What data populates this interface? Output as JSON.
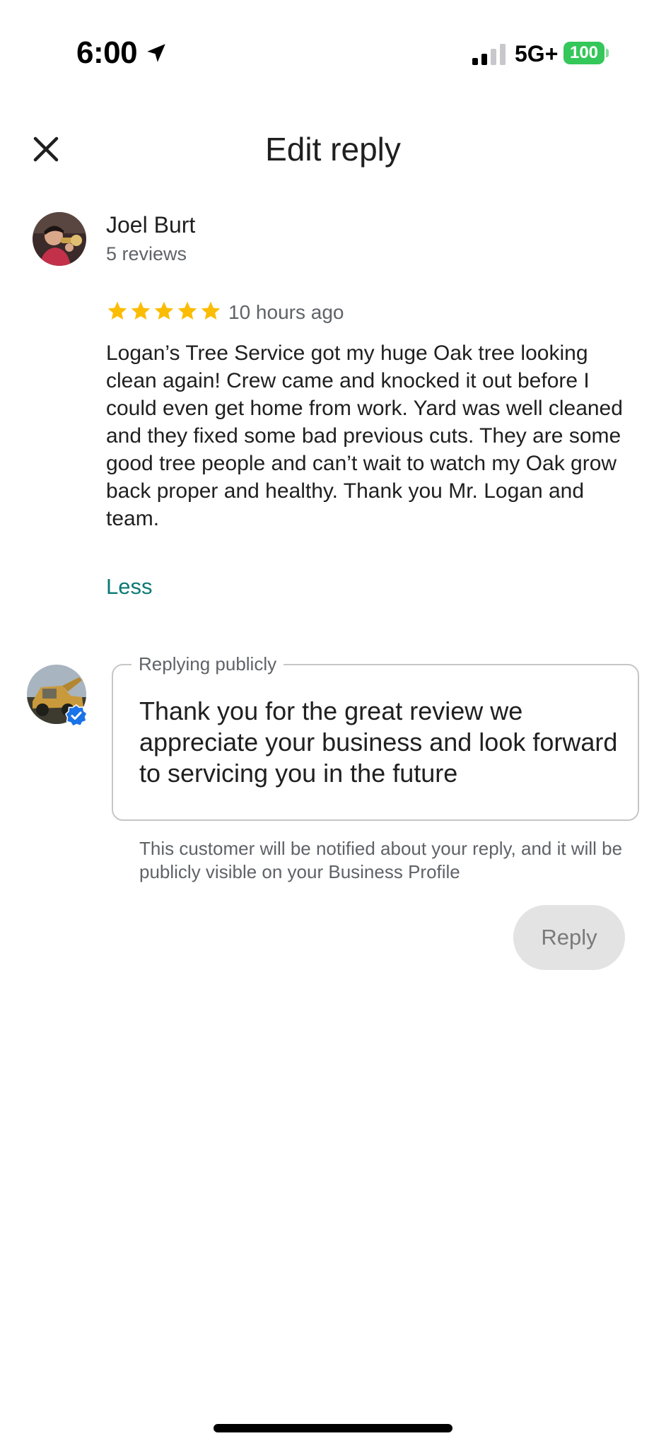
{
  "status_bar": {
    "time": "6:00",
    "network": "5G+",
    "battery": "100",
    "battery_color": "#34c759",
    "icons": [
      "location-arrow-icon",
      "signal-icon",
      "battery-icon"
    ]
  },
  "header": {
    "title": "Edit reply",
    "close_icon": "close-icon"
  },
  "review": {
    "reviewer_name": "Joel Burt",
    "reviewer_reviews": "5 reviews",
    "rating": 5,
    "rating_max": 5,
    "star_color": "#fbbc04",
    "time_ago": "10 hours ago",
    "text": "Logan’s Tree Service got my huge Oak tree looking clean again! Crew came and knocked it out before I could even get home from work. Yard was well cleaned and they fixed some bad previous cuts. They are some good tree people and can’t wait to watch my Oak grow back proper and healthy. Thank you Mr. Logan and team.",
    "less_label": "Less",
    "link_color": "#0b7a75"
  },
  "reply": {
    "label": "Replying publicly",
    "value": "Thank you for the great review we appreciate your business and look forward to servicing you in the future",
    "helper": "This customer will be notified about your reply, and it will be publicly visible on your Business Profile",
    "button_label": "Reply",
    "verified_color": "#1a73e8"
  }
}
